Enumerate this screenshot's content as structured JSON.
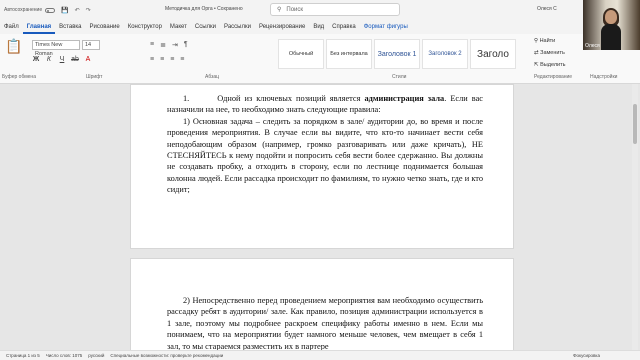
{
  "titlebar": {
    "autosave_label": "Автосохранение",
    "doc_title": "Методичка для Орга • Сохранено",
    "search_placeholder": "Поиск",
    "user_name": "Олеся С",
    "video_name": "Олеся"
  },
  "tabs": [
    "Файл",
    "Главная",
    "Вставка",
    "Рисование",
    "Конструктор",
    "Макет",
    "Ссылки",
    "Рассылки",
    "Рецензирование",
    "Вид",
    "Справка",
    "Формат фигуры"
  ],
  "active_tab": "Главная",
  "ribbon": {
    "paste_label": "Вставить",
    "clipboard_label": "Буфер обмена",
    "font_name": "Times New Roman",
    "font_size": "14",
    "font_group_label": "Шрифт",
    "paragraph_group_label": "Абзац",
    "styles_group_label": "Стили",
    "styles": [
      "Обычный",
      "Без интервала",
      "Заголовок 1",
      "Заголовок 2",
      "Заголо"
    ],
    "editing_find": "Найти",
    "editing_replace": "Заменить",
    "editing_select": "Выделить",
    "editing_group_label": "Редактирование",
    "addins_label": "Надстройки"
  },
  "document": {
    "p1_num": "1.",
    "p1_text_a": "Одной из ключевых позиций является ",
    "p1_bold": "администрация зала",
    "p1_text_b": ". Если вас назначили на нее, то необходимо знать следующие правила:",
    "p2": "1)      Основная задача – следить за порядком в зале/ аудитории до, во время и после проведения мероприятия. В случае если вы видите, что кто-то начинает вести себя неподобающим образом (например, громко разговаривать или даже кричать), НЕ СТЕСНЯЙТЕСЬ к нему подойти и попросить себя вести более сдержанно. Вы должны не создавать пробку, а отходить в сторону, если по лестнице поднимается большая колонна людей. Если рассадка происходит по фамилиям, то нужно четко знать, где и кто сидит;",
    "p3": "2)      Непосредственно перед проведением мероприятия вам необходимо осуществить рассадку ребят в аудитории/ зале. Как правило, позиция администрации используется в 1 зале, поэтому мы подробнее раскроем специфику работы именно в нем. Если мы понимаем, что на мероприятии будет намного меньше человек, чем вмещает в себя 1 зал, то мы стараемся разместить их в партере"
  },
  "statusbar": {
    "page": "Страница 1 из 5",
    "words": "Число слов: 1075",
    "lang": "русский",
    "accessibility": "Специальные возможности: проверьте рекомендации",
    "focus": "Фокусировка"
  }
}
